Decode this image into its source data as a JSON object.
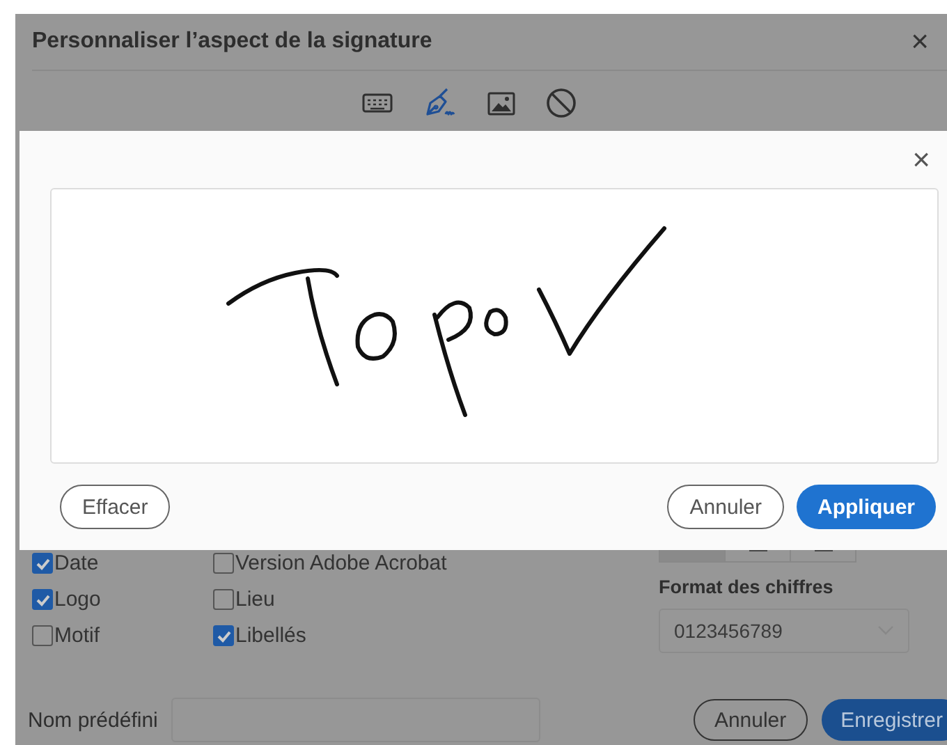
{
  "dialog": {
    "title": "Personnaliser l’aspect de la signature",
    "close": "×"
  },
  "mode_tabs": [
    {
      "kind": "keyboard",
      "selected": false
    },
    {
      "kind": "pen",
      "selected": true
    },
    {
      "kind": "image",
      "selected": false
    },
    {
      "kind": "none",
      "selected": false
    }
  ],
  "options": [
    {
      "label": "Date",
      "checked": true
    },
    {
      "label": "Version Adobe Acrobat",
      "checked": false
    },
    {
      "label": "Logo",
      "checked": true
    },
    {
      "label": "Lieu",
      "checked": false
    },
    {
      "label": "Motif",
      "checked": false
    },
    {
      "label": "Libellés",
      "checked": true
    }
  ],
  "align_buttons": [
    {
      "selected": true
    },
    {
      "selected": false
    },
    {
      "selected": false
    }
  ],
  "number_format": {
    "label": "Format des chiffres",
    "value": "0123456789"
  },
  "preset": {
    "label": "Nom prédéfini"
  },
  "footer_buttons": [
    "Annuler",
    "Enregistrer"
  ],
  "draw_modal": {
    "close": "×",
    "buttons": [
      "Effacer",
      "Annuler",
      "Appliquer"
    ]
  }
}
